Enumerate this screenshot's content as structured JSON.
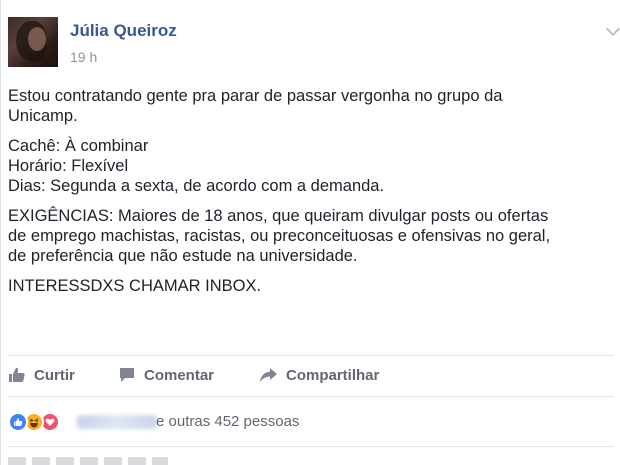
{
  "post": {
    "author": "Júlia Queiroz",
    "timestamp": "19 h",
    "text": {
      "line1": "Estou contratando gente pra parar de passar vergonha no grupo da",
      "line2": "Unicamp.",
      "line3": "Cachê: À combinar",
      "line4": "Horário: Flexível",
      "line5": "Dias: Segunda a sexta, de acordo com a demanda.",
      "line6": "EXIGÊNCIAS: Maiores de 18 anos, que queiram divulgar posts ou ofertas",
      "line7": "de emprego machistas, racistas, ou preconceituosas e ofensivas no geral,",
      "line8": "de preferência que não estude na universidade.",
      "line9": "INTERESSDXS CHAMAR INBOX."
    }
  },
  "actions": {
    "like_label": "Curtir",
    "comment_label": "Comentar",
    "share_label": "Compartilhar"
  },
  "reactions": {
    "icons": [
      "like-icon",
      "haha-icon",
      "love-icon"
    ],
    "summary": "e outras 452 pessoas"
  },
  "colors": {
    "link": "#365899",
    "muted": "#90949c",
    "action": "#606770",
    "like_blue": "#4080ff",
    "love_red": "#f25268",
    "haha_yellow": "#f7b125"
  }
}
